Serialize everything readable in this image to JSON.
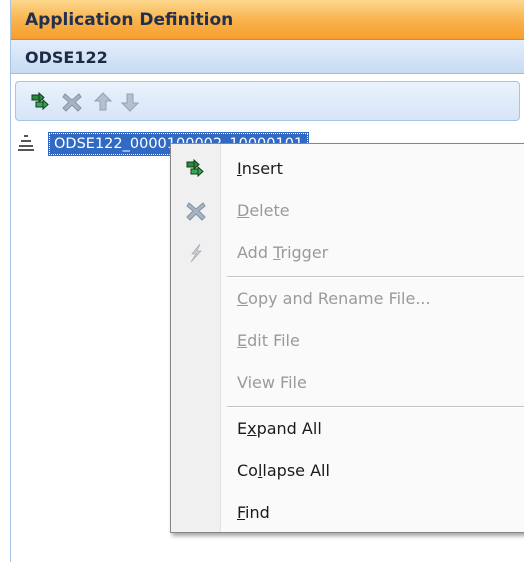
{
  "panel": {
    "title": "Application Definition",
    "subtitle": "ODSE122"
  },
  "toolbar": {
    "buttons": [
      {
        "name": "insert",
        "icon": "insert-arrows-icon",
        "enabled": true
      },
      {
        "name": "delete",
        "icon": "delete-x-icon",
        "enabled": false
      },
      {
        "name": "move-up",
        "icon": "arrow-up-icon",
        "enabled": false
      },
      {
        "name": "move-down",
        "icon": "arrow-down-icon",
        "enabled": false
      }
    ]
  },
  "tree": {
    "selected_node_label": "ODSE122_0000100002_10000101"
  },
  "context_menu": {
    "items": [
      {
        "pre": "",
        "mnemonic": "I",
        "post": "nsert",
        "icon": "insert-arrows-icon",
        "enabled": true
      },
      {
        "pre": "",
        "mnemonic": "D",
        "post": "elete",
        "icon": "delete-x-icon",
        "enabled": false
      },
      {
        "pre": "Add ",
        "mnemonic": "T",
        "post": "rigger",
        "icon": "lightning-icon",
        "enabled": false
      },
      {
        "pre": "",
        "mnemonic": "C",
        "post": "opy and Rename File...",
        "icon": "",
        "enabled": false
      },
      {
        "pre": "",
        "mnemonic": "E",
        "post": "dit File",
        "icon": "",
        "enabled": false
      },
      {
        "pre": "View File",
        "mnemonic": "",
        "post": "",
        "icon": "",
        "enabled": false
      },
      {
        "pre": "E",
        "mnemonic": "x",
        "post": "pand All",
        "icon": "",
        "enabled": true
      },
      {
        "pre": "Co",
        "mnemonic": "l",
        "post": "lapse All",
        "icon": "",
        "enabled": true
      },
      {
        "pre": "",
        "mnemonic": "F",
        "post": "ind",
        "icon": "",
        "enabled": true
      }
    ]
  },
  "colors": {
    "title_bar": "#f9b14a",
    "sub_bar": "#c7dbf3",
    "selection": "#316ac5",
    "disabled_text": "#9a9a9a"
  }
}
